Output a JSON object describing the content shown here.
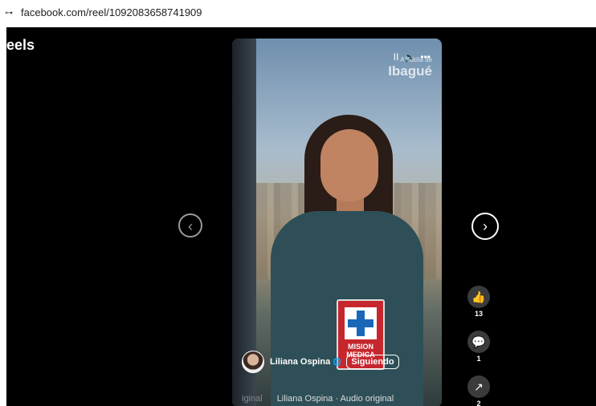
{
  "address_bar": {
    "url": "facebook.com/reel/1092083658741909",
    "site_info_icon": "tune-icon"
  },
  "page": {
    "title": "eels"
  },
  "video": {
    "brand_small": "Alcaldía de",
    "brand_big": "Ibagué",
    "badge_text_1": "MISION",
    "badge_text_2": "MEDICA",
    "controls": {
      "pause_icon": "pause-icon",
      "volume_icon": "volume-icon",
      "more_icon": "more-icon",
      "pause_glyph": "II",
      "volume_glyph": "🔈",
      "more_glyph": "•••"
    },
    "author": {
      "name": "Liliana Ospina",
      "privacy_icon": "globe-icon",
      "follow_label": "Siguiendo"
    },
    "audio": {
      "prefix": "iginal",
      "label": "Liliana Ospina · Audio original"
    }
  },
  "navigation": {
    "prev_icon": "chevron-left-icon",
    "next_icon": "chevron-right-icon",
    "prev_glyph": "‹",
    "next_glyph": "›"
  },
  "actions": {
    "like": {
      "icon": "thumbs-up-icon",
      "count": "13",
      "glyph": "👍"
    },
    "comment": {
      "icon": "comment-icon",
      "count": "1",
      "glyph": "💬"
    },
    "share": {
      "icon": "share-icon",
      "count": "2",
      "glyph": "↗"
    }
  }
}
